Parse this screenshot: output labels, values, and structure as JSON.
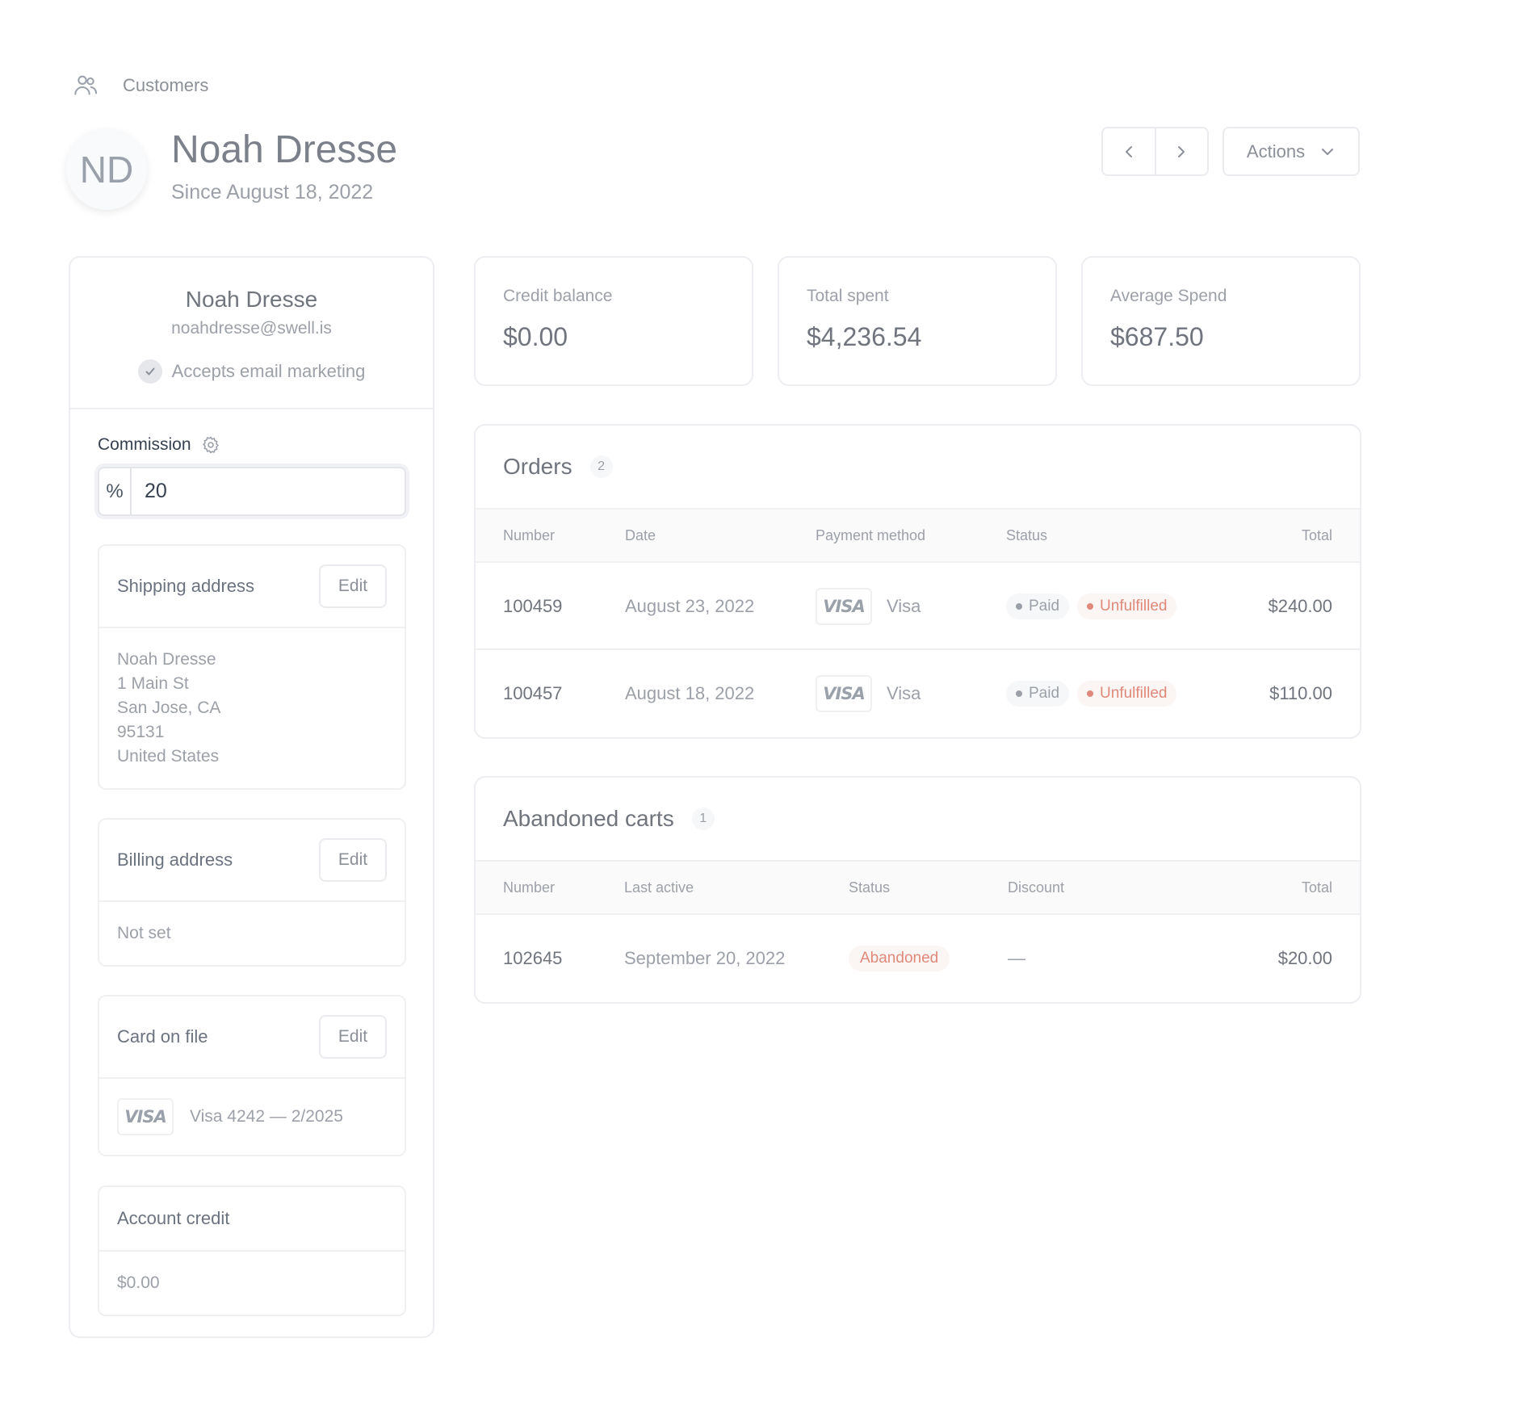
{
  "breadcrumb": {
    "label": "Customers",
    "icon": "users-icon"
  },
  "header": {
    "initials": "ND",
    "name": "Noah Dresse",
    "since": "Since August 18, 2022",
    "actions_label": "Actions"
  },
  "profile": {
    "name": "Noah Dresse",
    "email": "noahdresse@swell.is",
    "marketing": "Accepts email marketing"
  },
  "commission": {
    "label": "Commission",
    "prefix": "%",
    "value": "20"
  },
  "shipping": {
    "title": "Shipping address",
    "edit": "Edit",
    "lines": [
      "Noah Dresse",
      "1 Main St",
      "San Jose, CA",
      "95131",
      "United States"
    ]
  },
  "billing": {
    "title": "Billing address",
    "edit": "Edit",
    "value": "Not set"
  },
  "card": {
    "title": "Card on file",
    "edit": "Edit",
    "brand": "VISA",
    "value": "Visa 4242 — 2/2025"
  },
  "credit": {
    "title": "Account credit",
    "value": "$0.00"
  },
  "stats": [
    {
      "label": "Credit balance",
      "value": "$0.00"
    },
    {
      "label": "Total spent",
      "value": "$4,236.54"
    },
    {
      "label": "Average Spend",
      "value": "$687.50"
    }
  ],
  "orders": {
    "title": "Orders",
    "count": "2",
    "columns": [
      "Number",
      "Date",
      "Payment method",
      "Status",
      "Total"
    ],
    "rows": [
      {
        "number": "100459",
        "date": "August 23, 2022",
        "brand": "VISA",
        "method": "Visa",
        "status1": "Paid",
        "status2": "Unfulfilled",
        "total": "$240.00"
      },
      {
        "number": "100457",
        "date": "August 18, 2022",
        "brand": "VISA",
        "method": "Visa",
        "status1": "Paid",
        "status2": "Unfulfilled",
        "total": "$110.00"
      }
    ]
  },
  "carts": {
    "title": "Abandoned carts",
    "count": "1",
    "columns": [
      "Number",
      "Last active",
      "Status",
      "Discount",
      "Total"
    ],
    "rows": [
      {
        "number": "102645",
        "last_active": "September 20, 2022",
        "status": "Abandoned",
        "discount": "—",
        "total": "$20.00"
      }
    ]
  },
  "colors": {
    "accent_unfulfilled": "#e0897a",
    "muted_text": "#9ca0a8",
    "border": "#eceef1"
  }
}
